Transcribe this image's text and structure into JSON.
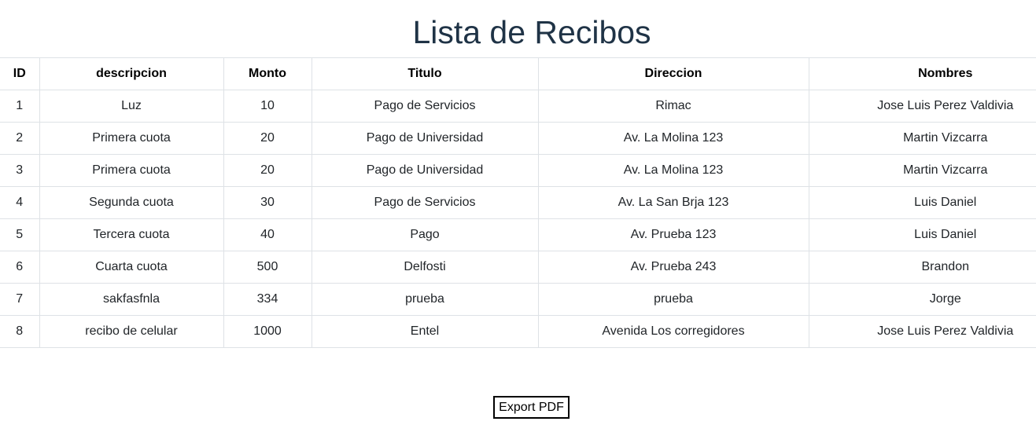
{
  "page": {
    "title": "Lista de Recibos"
  },
  "table": {
    "headers": [
      "ID",
      "descripcion",
      "Monto",
      "Titulo",
      "Direccion",
      "Nombres"
    ],
    "rows": [
      [
        "1",
        "Luz",
        "10",
        "Pago de Servicios",
        "Rimac",
        "Jose Luis Perez Valdivia"
      ],
      [
        "2",
        "Primera cuota",
        "20",
        "Pago de Universidad",
        "Av. La Molina 123",
        "Martin Vizcarra"
      ],
      [
        "3",
        "Primera cuota",
        "20",
        "Pago de Universidad",
        "Av. La Molina 123",
        "Martin Vizcarra"
      ],
      [
        "4",
        "Segunda cuota",
        "30",
        "Pago de Servicios",
        "Av. La San Brja 123",
        "Luis Daniel"
      ],
      [
        "5",
        "Tercera cuota",
        "40",
        "Pago",
        "Av. Prueba 123",
        "Luis Daniel"
      ],
      [
        "6",
        "Cuarta cuota",
        "500",
        "Delfosti",
        "Av. Prueba 243",
        "Brandon"
      ],
      [
        "7",
        "sakfasfnla",
        "334",
        "prueba",
        "prueba",
        "Jorge"
      ],
      [
        "8",
        "recibo de celular",
        "1000",
        "Entel",
        "Avenida Los corregidores",
        "Jose Luis Perez Valdivia"
      ]
    ]
  },
  "actions": {
    "export_label": "Export PDF"
  }
}
